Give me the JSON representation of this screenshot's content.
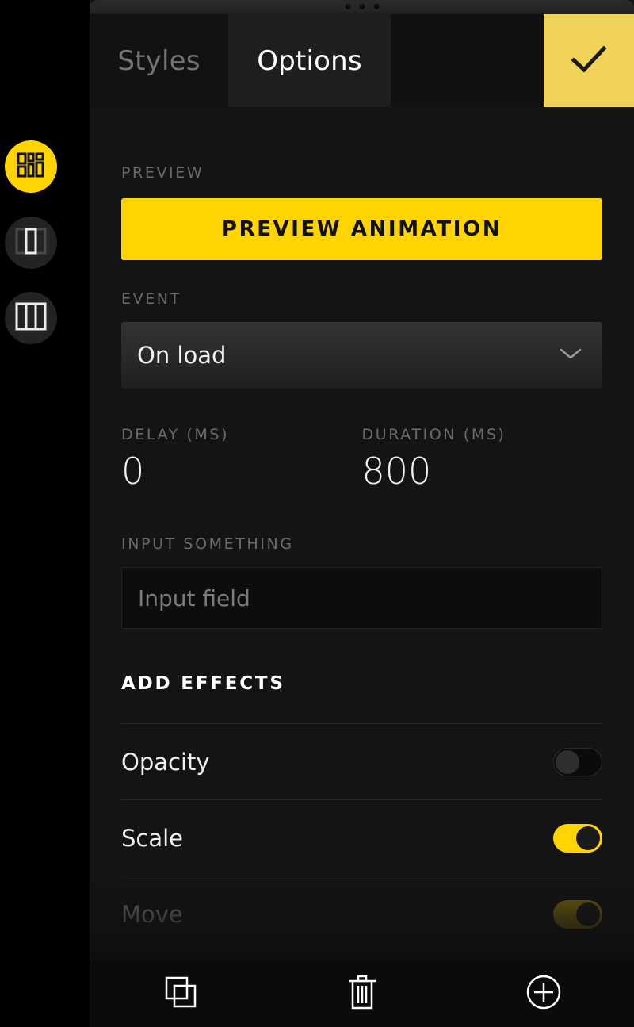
{
  "theme": {
    "accent": "#FFD400",
    "accent_soft": "#F2D35A",
    "panel_bg": "#141414",
    "rail_bg": "#000000",
    "toolbar_bg": "#0B0B0B",
    "label_color": "#6B6B6B",
    "text_color": "#F0F0F0"
  },
  "rail": {
    "items": [
      {
        "icon": "dashboard-grid-icon",
        "active": true
      },
      {
        "icon": "single-column-layout-icon",
        "active": false
      },
      {
        "icon": "three-column-layout-icon",
        "active": false
      }
    ]
  },
  "window": {
    "drag_handle": "drag-dots-handle"
  },
  "tabs": [
    {
      "label": "Styles",
      "active": false
    },
    {
      "label": "Options",
      "active": true
    }
  ],
  "confirm": {
    "icon": "checkmark-icon",
    "label": ""
  },
  "sections": {
    "preview": {
      "label": "PREVIEW",
      "button_label": "PREVIEW ANIMATION"
    },
    "event": {
      "label": "EVENT",
      "value": "On load",
      "chevron": "chevron-down-icon"
    },
    "delay": {
      "label": "DELAY (MS)",
      "value": "0"
    },
    "duration": {
      "label": "DURATION (MS)",
      "value": "800"
    },
    "input": {
      "label": "INPUT SOMETHING",
      "value": "",
      "placeholder": "Input field"
    },
    "effects": {
      "label": "ADD EFFECTS",
      "rows": [
        {
          "name": "Opacity",
          "on": false,
          "dim": false
        },
        {
          "name": "Scale",
          "on": true,
          "dim": false
        },
        {
          "name": "Move",
          "on": true,
          "dim": true
        }
      ]
    }
  },
  "toolbar": {
    "buttons": [
      {
        "icon": "duplicate-icon"
      },
      {
        "icon": "trash-icon"
      },
      {
        "icon": "add-circle-icon"
      }
    ]
  }
}
